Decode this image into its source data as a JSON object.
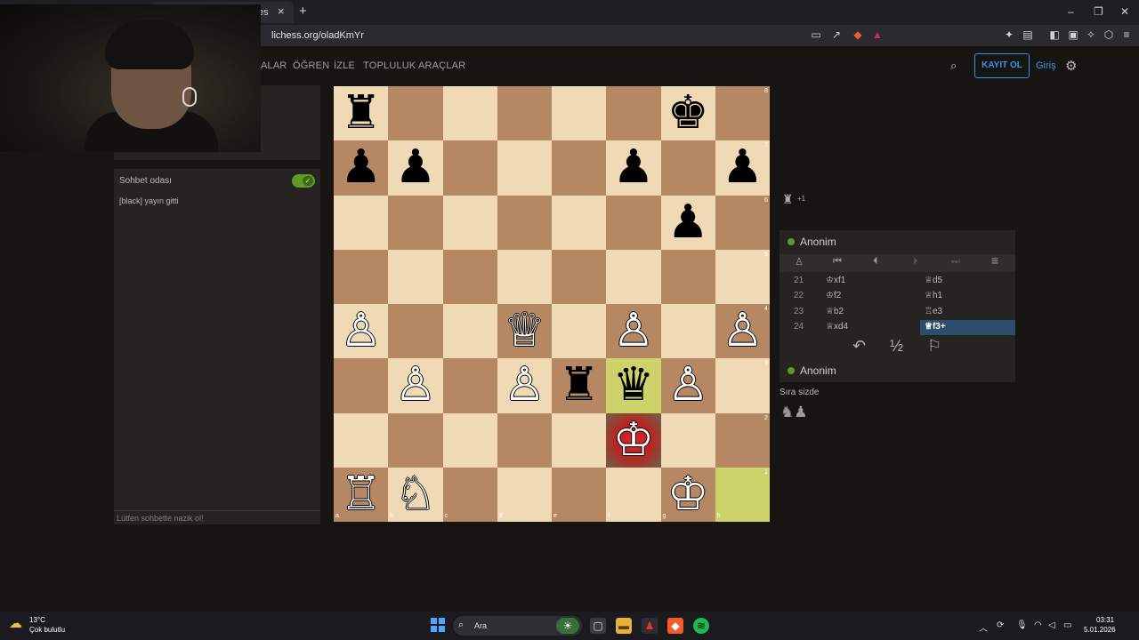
{
  "browser": {
    "tab_title": "es",
    "close_glyph": "×",
    "new_tab_glyph": "+",
    "url_prefix": "",
    "url": "lichess.org/oladKmYr",
    "window_buttons": [
      "–",
      "❐",
      "✕"
    ]
  },
  "nav": {
    "items": [
      "ALAR",
      "ÖĞREN",
      "İZLE",
      "TOPLULUK",
      "ARAÇLAR"
    ],
    "signup": "KAYIT OL",
    "login": "Giriş"
  },
  "chat": {
    "title": "Sohbet odası",
    "toggle_on": true,
    "toggle_glyph": "✓",
    "message": "[black] yayın gitti",
    "placeholder": "Lütfen sohbette nazik ol!"
  },
  "board": {
    "files": [
      "a",
      "b",
      "c",
      "d",
      "e",
      "f",
      "g",
      "h"
    ],
    "ranks": [
      "8",
      "7",
      "6",
      "5",
      "4",
      "3",
      "2",
      "1"
    ],
    "pieces": [
      {
        "sq": "a8",
        "glyph": "♜",
        "color": "black"
      },
      {
        "sq": "g8",
        "glyph": "♚",
        "color": "black"
      },
      {
        "sq": "a7",
        "glyph": "♟",
        "color": "black"
      },
      {
        "sq": "b7",
        "glyph": "♟",
        "color": "black"
      },
      {
        "sq": "f7",
        "glyph": "♟",
        "color": "black"
      },
      {
        "sq": "h7",
        "glyph": "♟",
        "color": "black"
      },
      {
        "sq": "g6",
        "glyph": "♟",
        "color": "black"
      },
      {
        "sq": "a4",
        "glyph": "♙",
        "color": "white"
      },
      {
        "sq": "d4",
        "glyph": "♕",
        "color": "white"
      },
      {
        "sq": "f4",
        "glyph": "♙",
        "color": "white"
      },
      {
        "sq": "h4",
        "glyph": "♙",
        "color": "white"
      },
      {
        "sq": "b3",
        "glyph": "♙",
        "color": "white"
      },
      {
        "sq": "d3",
        "glyph": "♙",
        "color": "white"
      },
      {
        "sq": "e3",
        "glyph": "♜",
        "color": "black"
      },
      {
        "sq": "f3",
        "glyph": "♛",
        "color": "black"
      },
      {
        "sq": "g3",
        "glyph": "♙",
        "color": "white"
      },
      {
        "sq": "f2",
        "glyph": "♔",
        "color": "white"
      },
      {
        "sq": "a1",
        "glyph": "♖",
        "color": "white"
      },
      {
        "sq": "b1",
        "glyph": "♘",
        "color": "white"
      },
      {
        "sq": "g1",
        "glyph": "♔",
        "color": "white"
      }
    ],
    "highlight_last_move": [
      "h1",
      "f3"
    ],
    "check_square": "f2",
    "last_move_color": "#cdd26a",
    "check_color": "#e02828"
  },
  "side": {
    "captured_glyph": "♜",
    "captured_diff": "+1",
    "top_player": "Anonim",
    "bottom_player": "Anonim",
    "controls": [
      "♙",
      "⏮",
      "⏴",
      "⏵",
      "⏭",
      "≡"
    ],
    "moves": [
      {
        "n": "21",
        "w": "♔xf1",
        "b": "♕d5"
      },
      {
        "n": "22",
        "w": "♔f2",
        "b": "♕h1"
      },
      {
        "n": "23",
        "w": "♕b2",
        "b": "♖e3"
      },
      {
        "n": "24",
        "w": "♕xd4",
        "b": "♕f3+"
      }
    ],
    "actions": [
      "↶",
      "½",
      "⚐"
    ],
    "turn_text": "Sıra sizde",
    "turn_pieces": "♞♟"
  },
  "taskbar": {
    "weather_temp": "13°C",
    "weather_desc": "Çok bulutlu",
    "search_text": "Ara",
    "time": "03:31",
    "date": "5.01.2026"
  },
  "colors": {
    "accent": "#3692e7",
    "online": "#629924",
    "light_square": "#f0d9b5",
    "dark_square": "#b58863"
  }
}
